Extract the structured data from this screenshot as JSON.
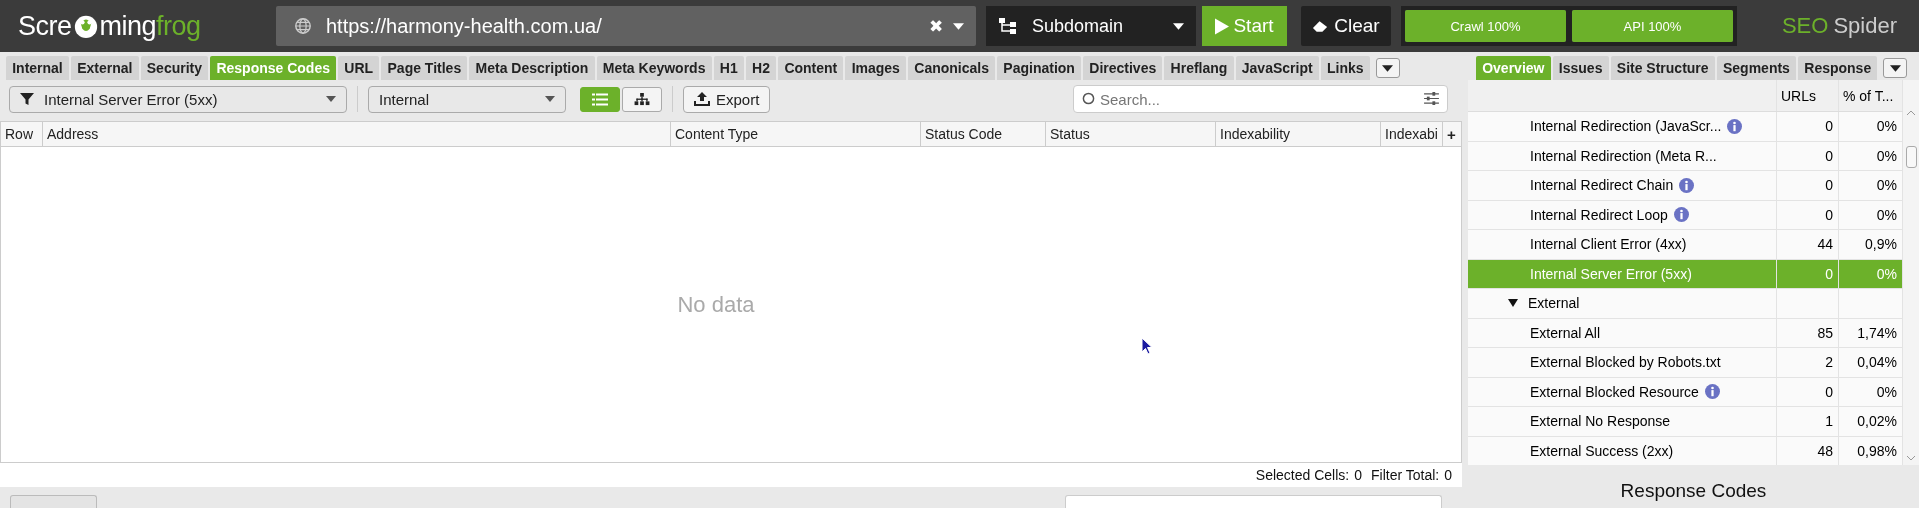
{
  "logo": {
    "before": "Scre",
    "after": "ming",
    "accent": "frog"
  },
  "url_field": {
    "value": "https://harmony-health.com.ua/",
    "clear": "✖"
  },
  "mode_dropdown": {
    "value": "Subdomain"
  },
  "start_button": "Start",
  "clear_button": "Clear",
  "progress": [
    {
      "label": "Crawl 100%",
      "level": 1
    },
    {
      "label": "API 100%",
      "level": 1
    }
  ],
  "brand": {
    "accent": "SEO",
    "name": "Spider"
  },
  "tabs": [
    {
      "label": "Internal",
      "selected": false
    },
    {
      "label": "External",
      "selected": false
    },
    {
      "label": "Security",
      "selected": false
    },
    {
      "label": "Response Codes",
      "selected": true
    },
    {
      "label": "URL",
      "selected": false
    },
    {
      "label": "Page Titles",
      "selected": false
    },
    {
      "label": "Meta Description",
      "selected": false
    },
    {
      "label": "Meta Keywords",
      "selected": false
    },
    {
      "label": "H1",
      "selected": false
    },
    {
      "label": "H2",
      "selected": false
    },
    {
      "label": "Content",
      "selected": false
    },
    {
      "label": "Images",
      "selected": false
    },
    {
      "label": "Canonicals",
      "selected": false
    },
    {
      "label": "Pagination",
      "selected": false
    },
    {
      "label": "Directives",
      "selected": false
    },
    {
      "label": "Hreflang",
      "selected": false
    },
    {
      "label": "JavaScript",
      "selected": false
    },
    {
      "label": "Links",
      "selected": false
    }
  ],
  "filter": {
    "value": "Internal Server Error (5xx)"
  },
  "scope": {
    "value": "Internal"
  },
  "view_toggle": [
    {
      "kind": "list",
      "selected": true
    },
    {
      "kind": "tree",
      "selected": false
    }
  ],
  "export_button": "Export",
  "search": {
    "placeholder": "Search..."
  },
  "table": {
    "columns": [
      "Row",
      "Address",
      "Content Type",
      "Status Code",
      "Status",
      "Indexability",
      "Indexabi"
    ],
    "add_column": "+",
    "empty": "No data"
  },
  "status_bar": {
    "selected_label": "Selected Cells:",
    "selected_value": "0",
    "total_label": "Filter Total:",
    "total_value": "0"
  },
  "right_tabs": [
    {
      "label": "Overview",
      "selected": true
    },
    {
      "label": "Issues",
      "selected": false
    },
    {
      "label": "Site Structure",
      "selected": false
    },
    {
      "label": "Segments",
      "selected": false
    },
    {
      "label": "Response",
      "selected": false
    }
  ],
  "overview": {
    "columns": [
      "URLs",
      "% of T..."
    ],
    "rows": [
      {
        "label": "Internal Redirection (JavaScr...",
        "info": true,
        "urls": "0",
        "percent": "0%",
        "selected": false
      },
      {
        "label": "Internal Redirection (Meta R...",
        "info": false,
        "urls": "0",
        "percent": "0%",
        "selected": false
      },
      {
        "label": "Internal Redirect Chain",
        "info": true,
        "urls": "0",
        "percent": "0%",
        "selected": false
      },
      {
        "label": "Internal Redirect Loop",
        "info": true,
        "urls": "0",
        "percent": "0%",
        "selected": false
      },
      {
        "label": "Internal Client Error (4xx)",
        "info": false,
        "urls": "44",
        "percent": "0,9%",
        "selected": false
      },
      {
        "label": "Internal Server Error (5xx)",
        "info": false,
        "urls": "0",
        "percent": "0%",
        "selected": true
      }
    ],
    "groups": [
      {
        "label": "External",
        "expanded": true,
        "children": [
          {
            "label": "External All",
            "info": false,
            "urls": "85",
            "percent": "1,74%",
            "selected": false
          },
          {
            "label": "External Blocked by Robots.txt",
            "info": false,
            "urls": "2",
            "percent": "0,04%",
            "selected": false
          },
          {
            "label": "External Blocked Resource",
            "info": true,
            "urls": "0",
            "percent": "0%",
            "selected": false
          },
          {
            "label": "External No Response",
            "info": false,
            "urls": "1",
            "percent": "0,02%",
            "selected": false
          },
          {
            "label": "External Success (2xx)",
            "info": false,
            "urls": "48",
            "percent": "0,98%",
            "selected": false
          }
        ]
      }
    ]
  },
  "bottom_title": "Response Codes"
}
